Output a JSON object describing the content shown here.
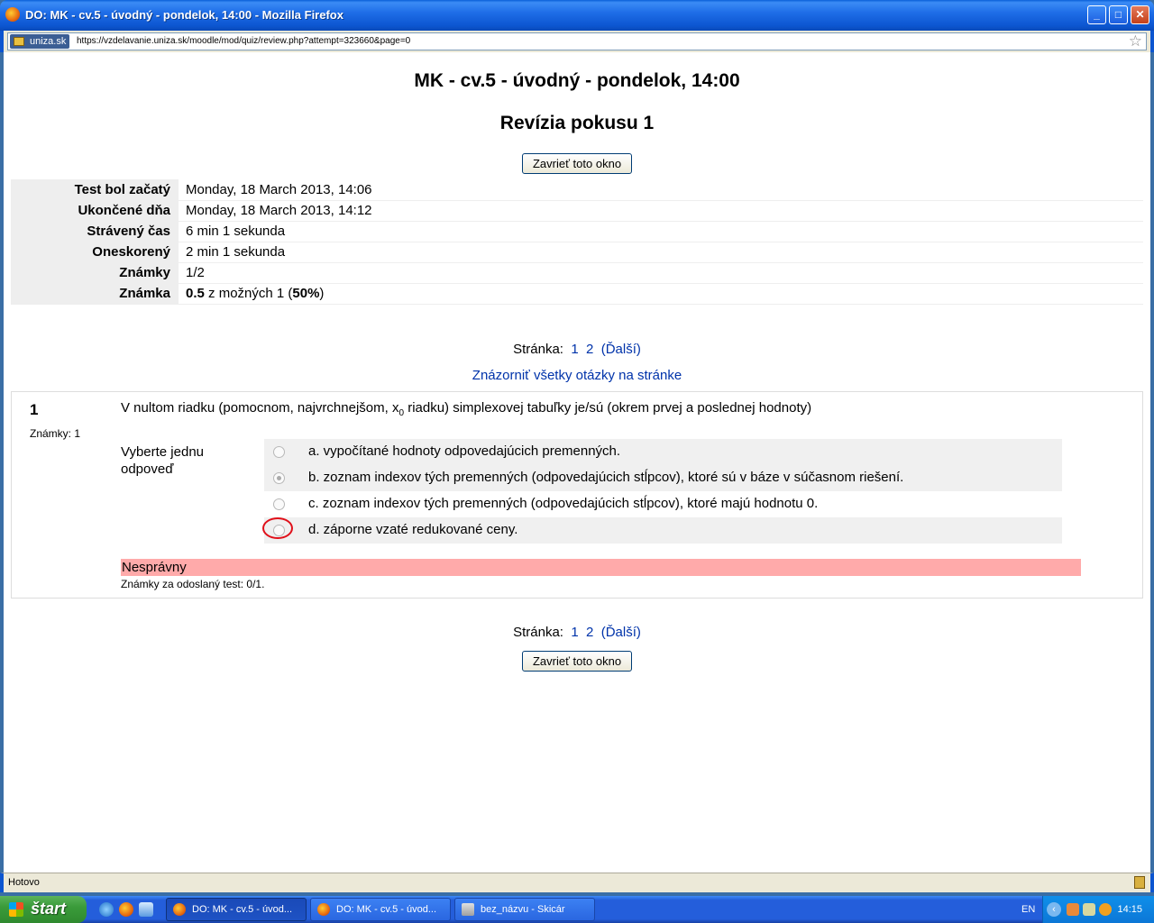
{
  "window": {
    "title": "DO: MK - cv.5 - úvodný - pondelok, 14:00 - Mozilla Firefox",
    "controls": {
      "minimize": "_",
      "maximize": "□",
      "close": "✕"
    }
  },
  "addressbar": {
    "site": "uniza.sk",
    "url": "https://vzdelavanie.uniza.sk/moodle/mod/quiz/review.php?attempt=323660&page=0",
    "bookmark_icon": "☆"
  },
  "page": {
    "title": "MK - cv.5 - úvodný - pondelok, 14:00",
    "subtitle": "Revízia pokusu 1",
    "close_button": "Zavrieť toto okno",
    "summary": [
      {
        "label": "Test bol začatý",
        "value": "Monday, 18 March 2013, 14:06"
      },
      {
        "label": "Ukončené dňa",
        "value": "Monday, 18 March 2013, 14:12"
      },
      {
        "label": "Strávený čas",
        "value": "6 min 1 sekunda"
      },
      {
        "label": "Oneskorený",
        "value": "2 min 1 sekunda"
      },
      {
        "label": "Známky",
        "value": "1/2"
      },
      {
        "label": "Známka",
        "value_bold": "0.5",
        "value_mid": " z možných 1 (",
        "value_pct": "50%",
        "value_end": ")"
      }
    ],
    "pager": {
      "label": "Stránka:",
      "page1": "1",
      "page2": "2",
      "next": "(Ďalší)"
    },
    "show_all": "Znázorniť všetky otázky na stránke",
    "question": {
      "number": "1",
      "marks": "Známky: 1",
      "text_before": "V nultom riadku (pomocnom, najvrchnejšom, x",
      "text_sub": "0",
      "text_after": " riadku) simplexovej tabuľky je/sú (okrem prvej a poslednej hodnoty)",
      "prompt": "Vyberte jednu odpoveď",
      "answers": [
        {
          "text": "a. vypočítané hodnoty odpovedajúcich premenných.",
          "checked": false
        },
        {
          "text": "b. zoznam indexov tých premenných (odpovedajúcich stĺpcov), ktoré sú v báze v súčasnom riešení.",
          "checked": true
        },
        {
          "text": "c. zoznam indexov tých premenných (odpovedajúcich stĺpcov), ktoré majú hodnotu 0.",
          "checked": false
        },
        {
          "text": "d. záporne vzaté redukované ceny.",
          "checked": false
        }
      ],
      "feedback": "Nesprávny",
      "feedback_marks": "Známky za odoslaný test: 0/1."
    }
  },
  "statusbar": {
    "text": "Hotovo"
  },
  "taskbar": {
    "start": "štart",
    "tasks": [
      {
        "label": "DO: MK - cv.5 - úvod...",
        "icon": "firefox-icon"
      },
      {
        "label": "DO: MK - cv.5 - úvod...",
        "icon": "firefox-icon"
      },
      {
        "label": "bez_názvu - Skicár",
        "icon": "paint-icon"
      }
    ],
    "language": "EN",
    "clock": "14:15"
  }
}
